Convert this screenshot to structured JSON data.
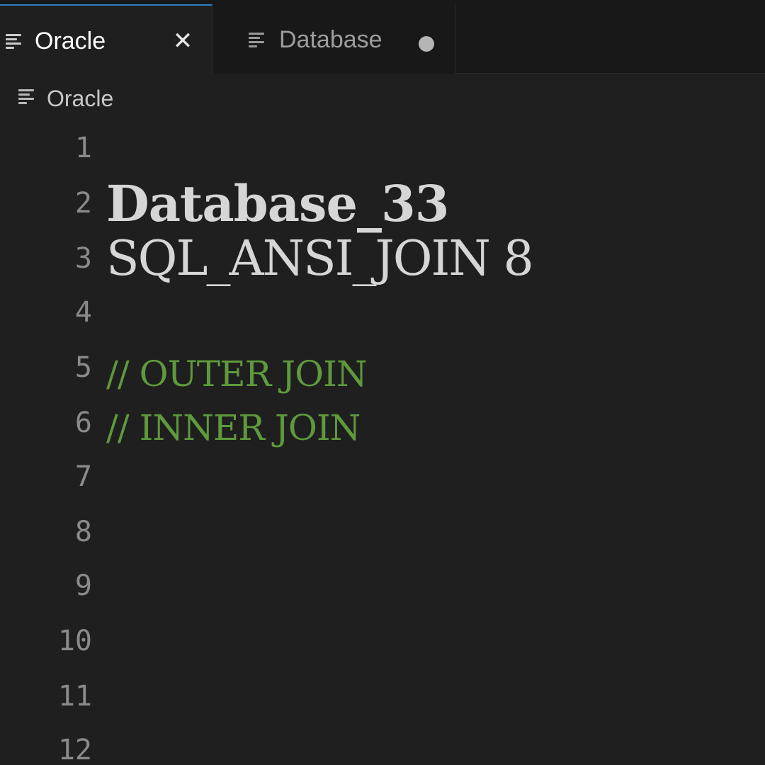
{
  "tabs": [
    {
      "label": "Oracle",
      "active": true,
      "icon": "lines-icon",
      "action_icon": "close-icon",
      "action_glyph": "✕"
    },
    {
      "label": "Database",
      "active": false,
      "icon": "lines-icon",
      "action_icon": "modified-dot-icon"
    }
  ],
  "breadcrumb": {
    "label": "Oracle",
    "icon": "lines-icon"
  },
  "editor": {
    "line_numbers": [
      "1",
      "2",
      "3",
      "4",
      "5",
      "6",
      "7",
      "8",
      "9",
      "10",
      "11",
      "12"
    ],
    "lines": {
      "l2": "Database_33",
      "l3": "SQL_ANSI_JOIN 8",
      "l5": "// OUTER JOIN",
      "l6": "// INNER JOIN"
    }
  },
  "colors": {
    "background": "#1f1f1f",
    "tabbar": "#181818",
    "active_tab_accent": "#2f7fc1",
    "text": "#d6d6d6",
    "comment": "#5e9a3c",
    "line_number": "#8a8a8a"
  }
}
